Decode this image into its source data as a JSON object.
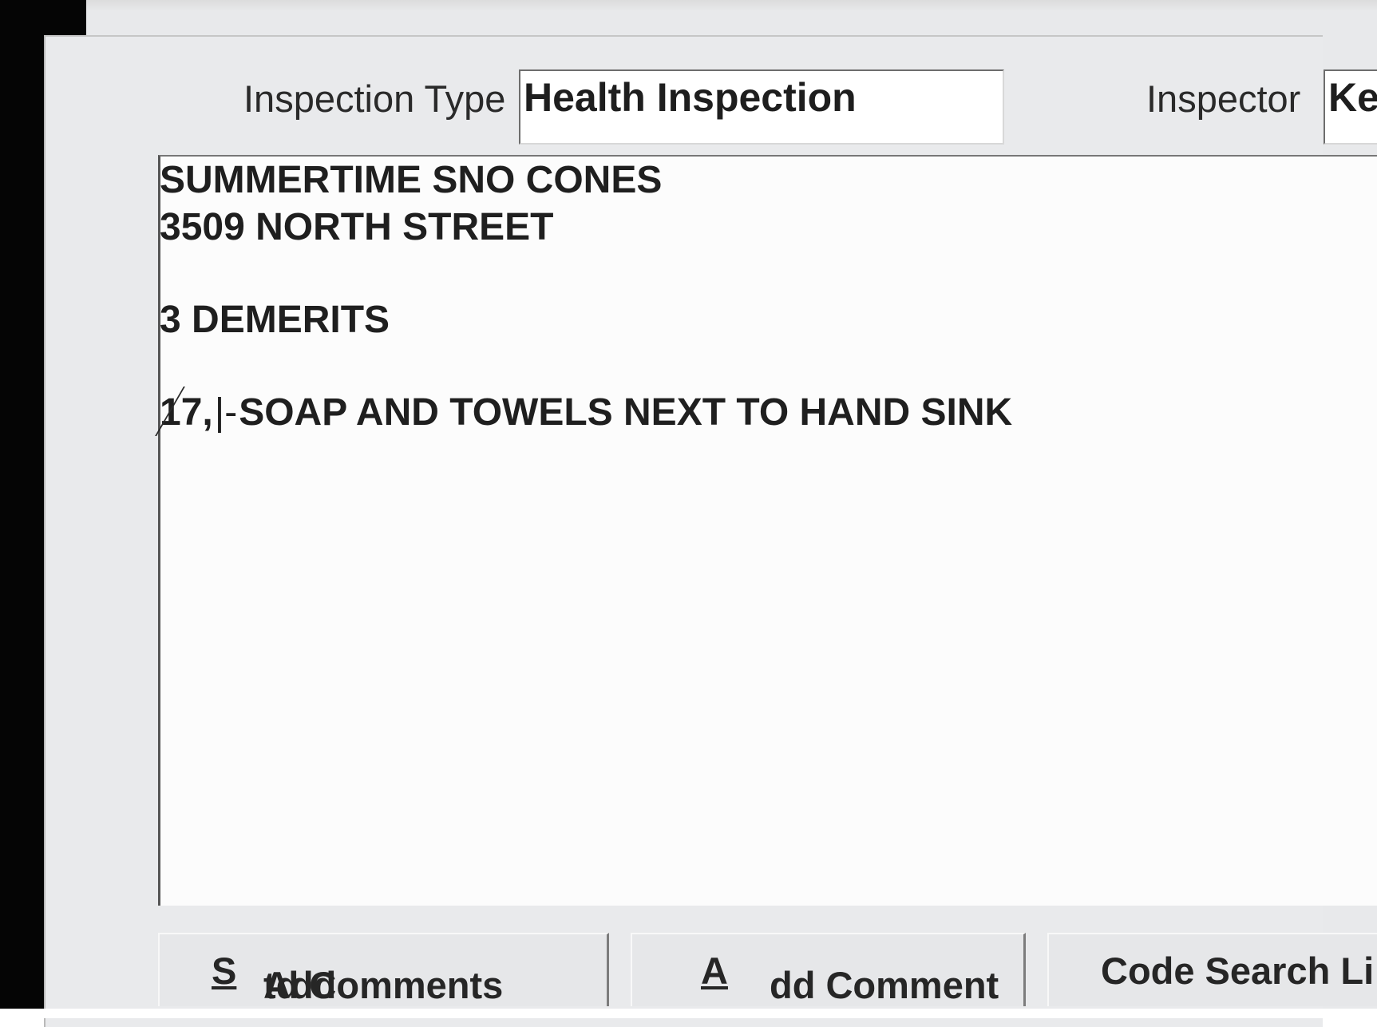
{
  "form": {
    "inspection_type_label": "Inspection Type",
    "inspection_type_value": "Health Inspection",
    "inspector_label": "Inspector",
    "inspector_value": "Ke"
  },
  "comments": {
    "establishment_name": "SUMMERTIME SNO CONES",
    "address": "3509 NORTH STREET",
    "demerits": "3 DEMERITS",
    "violation_code": "17,",
    "violation_text": "SOAP AND TOWELS NEXT TO HAND SINK"
  },
  "buttons": {
    "add_std_comments_pre": "Add ",
    "add_std_comments_mnemonic": "S",
    "add_std_comments_post": "td Comments",
    "add_comment_mnemonic": "A",
    "add_comment_post": "dd Comment",
    "code_search_label": "Code Search Li"
  }
}
